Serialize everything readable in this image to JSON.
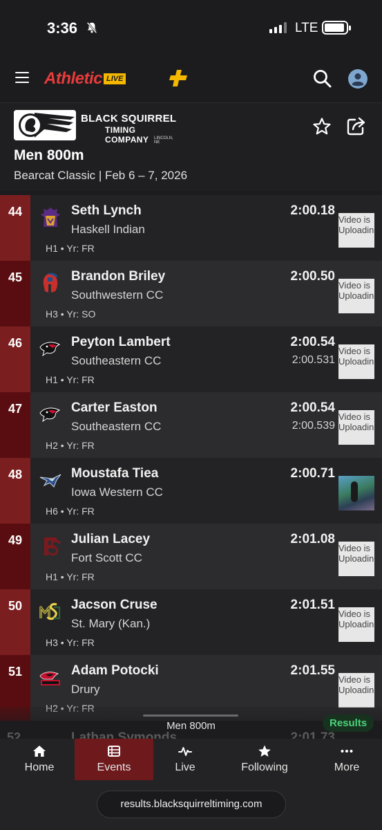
{
  "status": {
    "time": "3:36",
    "network": "LTE"
  },
  "brand": {
    "word": "Athletic",
    "badge": "LIVE"
  },
  "timing_company": {
    "title": "BLACK SQUIRREL",
    "subtitle": "TIMING COMPANY",
    "location": "LINCOLN, NE"
  },
  "event": {
    "title": "Men 800m",
    "meet": "Bearcat Classic | Feb 6 – 7, 2026"
  },
  "results": [
    {
      "place": "44",
      "name": "Seth Lynch",
      "team": "Haskell Indian",
      "mark": "2:00.18",
      "mark_detail": "",
      "heat_year": "H1 • Yr: FR",
      "video": "Video is\nUploading",
      "logo": "haskell-logo-icon"
    },
    {
      "place": "45",
      "name": "Brandon Briley",
      "team": "Southwestern CC",
      "mark": "2:00.50",
      "mark_detail": "",
      "heat_year": "H3 • Yr: SO",
      "video": "Video is\nUploading",
      "logo": "spartan-helmet-logo-icon"
    },
    {
      "place": "46",
      "name": "Peyton Lambert",
      "team": "Southeastern CC",
      "mark": "2:00.54",
      "mark_detail": "2:00.531",
      "heat_year": "H1 • Yr: FR",
      "video": "Video is\nUploading",
      "logo": "blackhawk-logo-icon"
    },
    {
      "place": "47",
      "name": "Carter Easton",
      "team": "Southeastern CC",
      "mark": "2:00.54",
      "mark_detail": "2:00.539",
      "heat_year": "H2 • Yr: FR",
      "video": "Video is\nUploading",
      "logo": "blackhawk-logo-icon"
    },
    {
      "place": "48",
      "name": "Moustafa Tiea",
      "team": "Iowa Western CC",
      "mark": "2:00.71",
      "mark_detail": "",
      "heat_year": "H6 • Yr: FR",
      "video": "",
      "logo": "reiver-bird-logo-icon"
    },
    {
      "place": "49",
      "name": "Julian Lacey",
      "team": "Fort Scott CC",
      "mark": "2:01.08",
      "mark_detail": "",
      "heat_year": "H1 • Yr: FR",
      "video": "Video is\nUploading",
      "logo": "fs-monogram-logo-icon"
    },
    {
      "place": "50",
      "name": "Jacson Cruse",
      "team": "St. Mary (Kan.)",
      "mark": "2:01.51",
      "mark_detail": "",
      "heat_year": "H3 • Yr: FR",
      "video": "Video is\nUploading",
      "logo": "spm-monogram-logo-icon"
    },
    {
      "place": "51",
      "name": "Adam Potocki",
      "team": "Drury",
      "mark": "2:01.55",
      "mark_detail": "",
      "heat_year": "H2 • Yr: FR",
      "video": "Video is\nUploading",
      "logo": "drury-logo-icon"
    }
  ],
  "peek": {
    "place": "52",
    "name": "Lathan Symonds",
    "mark": "2:01.73"
  },
  "sheet": {
    "label": "Men 800m",
    "results_button": "Results"
  },
  "tabs": [
    {
      "label": "Home",
      "icon": "home-icon"
    },
    {
      "label": "Events",
      "icon": "list-icon"
    },
    {
      "label": "Live",
      "icon": "pulse-icon"
    },
    {
      "label": "Following",
      "icon": "star-icon"
    },
    {
      "label": "More",
      "icon": "more-icon"
    }
  ],
  "url": "results.blacksquirreltiming.com",
  "colors": {
    "accent_red": "#7a1e20",
    "dark_red": "#5a0d10",
    "results_green": "#4cd17a",
    "brand_red": "#e83b3b",
    "brand_yellow": "#f5b800"
  }
}
